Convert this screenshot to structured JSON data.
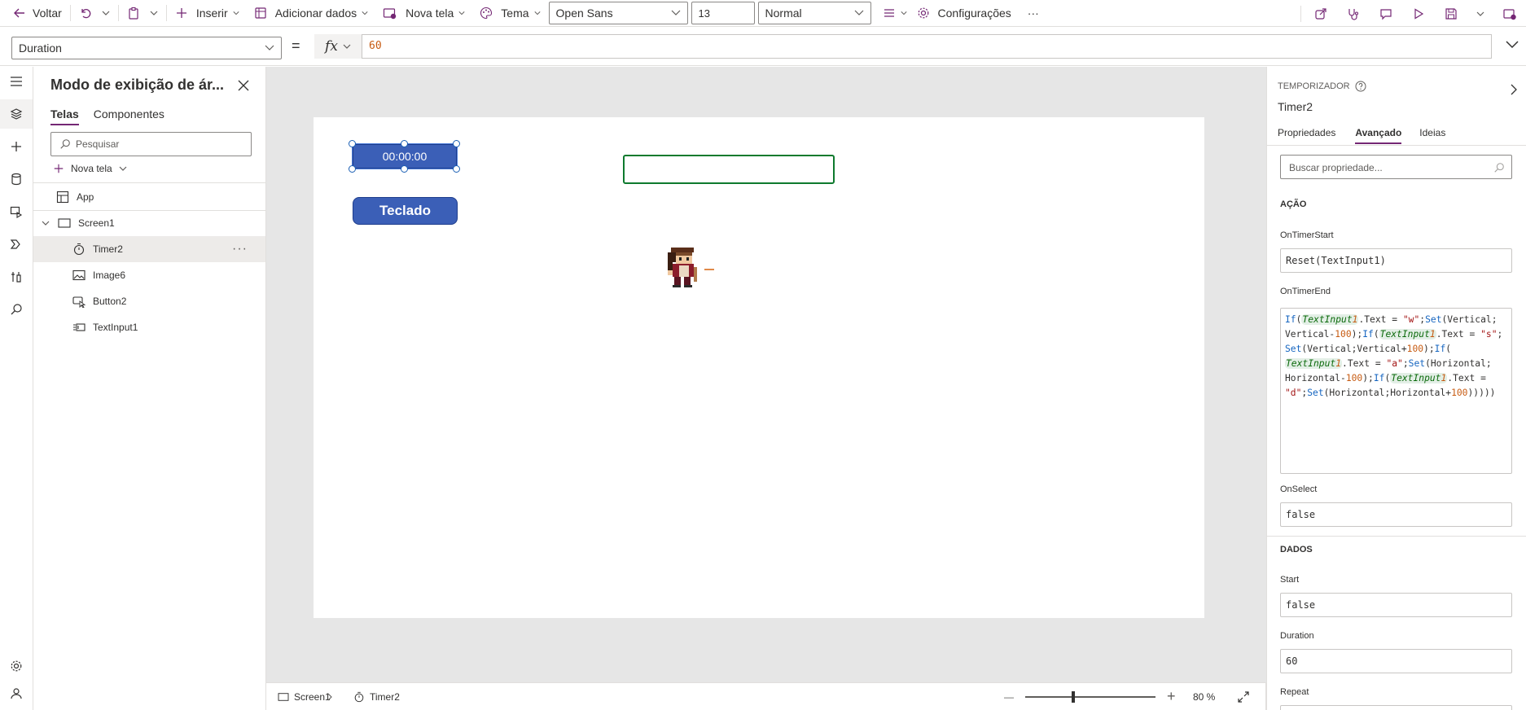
{
  "toolbar": {
    "back_label": "Voltar",
    "insert_label": "Inserir",
    "add_data_label": "Adicionar dados",
    "new_screen_label": "Nova tela",
    "theme_label": "Tema",
    "font_value": "Open Sans",
    "font_size_value": "13",
    "font_weight_value": "Normal",
    "settings_label": "Configurações",
    "more_label": "···"
  },
  "formula_bar": {
    "property": "Duration",
    "equals": "=",
    "fx_label": "fx",
    "formula": "60"
  },
  "tree_view": {
    "title": "Modo de exibição de ár...",
    "tabs": [
      "Telas",
      "Componentes"
    ],
    "search_placeholder": "Pesquisar",
    "new_screen_label": "Nova tela",
    "items": [
      {
        "label": "App",
        "icon": "app-icon"
      },
      {
        "label": "Screen1",
        "icon": "screen-icon"
      },
      {
        "label": "Timer2",
        "icon": "timer-icon"
      },
      {
        "label": "Image6",
        "icon": "image-icon"
      },
      {
        "label": "Button2",
        "icon": "button-icon"
      },
      {
        "label": "TextInput1",
        "icon": "text-input-icon"
      }
    ],
    "more_label": "···"
  },
  "canvas": {
    "timer_text": "00:00:00",
    "button_text": "Teclado"
  },
  "status_bar": {
    "screen_crumb": "Screen1",
    "control_crumb": "Timer2",
    "zoom_minus": "—",
    "zoom_plus": "+",
    "zoom_level": "80  %"
  },
  "properties": {
    "control_type": "TEMPORIZADOR",
    "control_name": "Timer2",
    "tabs": [
      "Propriedades",
      "Avançado",
      "Ideias"
    ],
    "search_placeholder": "Buscar propriedade...",
    "section_action": "AÇÃO",
    "on_timer_start_label": "OnTimerStart",
    "on_timer_start_value": "Reset(TextInput1)",
    "on_timer_end_label": "OnTimerEnd",
    "on_timer_end_value": "If(TextInput1.Text = \"w\";Set(Vertical;Vertical-100);If(TextInput1.Text = \"s\";Set(Vertical;Vertical+100);If(TextInput1.Text = \"a\";Set(Horizontal;Horizontal-100);If(TextInput1.Text = \"d\";Set(Horizontal;Horizontal+100)))))",
    "on_select_label": "OnSelect",
    "on_select_value": "false",
    "section_data": "DADOS",
    "start_label": "Start",
    "start_value": "false",
    "duration_label": "Duration",
    "duration_value": "60",
    "repeat_label": "Repeat"
  },
  "colors": {
    "accent": "#742774",
    "control_fill": "#3b5fb7",
    "input_border": "#0e7a2e",
    "canvas_bg": "#e6e6e6"
  }
}
